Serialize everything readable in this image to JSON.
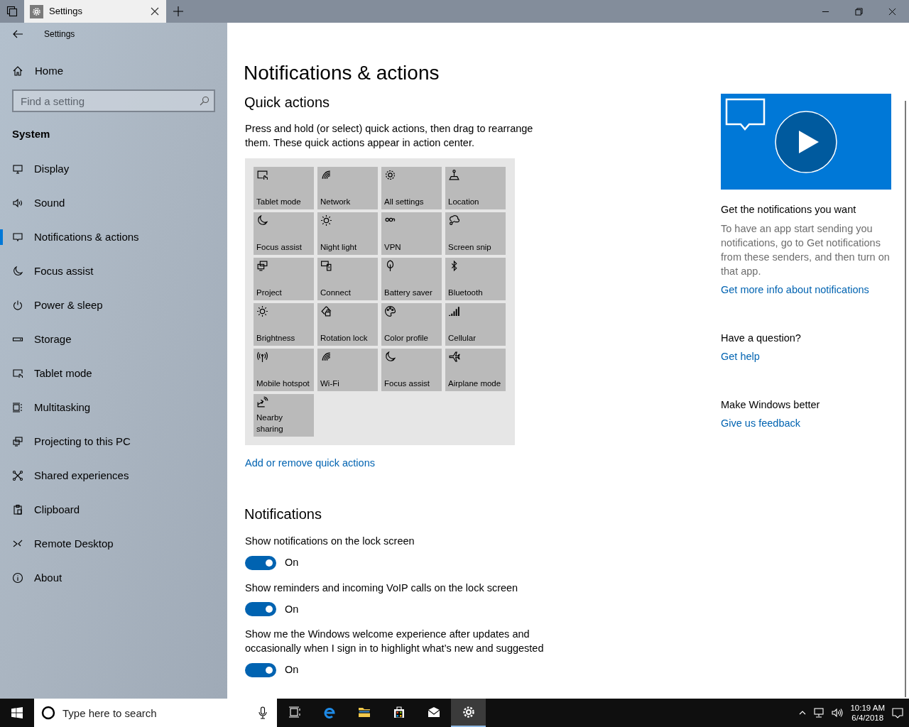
{
  "tabs": [
    {
      "label": "Settings",
      "selected": true
    }
  ],
  "window": {
    "title": "Settings"
  },
  "sidebar": {
    "home": "Home",
    "search": {
      "placeholder": "Find a setting"
    },
    "section": "System",
    "items": [
      {
        "label": "Display",
        "selected": false
      },
      {
        "label": "Sound",
        "selected": false
      },
      {
        "label": "Notifications & actions",
        "selected": true
      },
      {
        "label": "Focus assist",
        "selected": false
      },
      {
        "label": "Power & sleep",
        "selected": false
      },
      {
        "label": "Storage",
        "selected": false
      },
      {
        "label": "Tablet mode",
        "selected": false
      },
      {
        "label": "Multitasking",
        "selected": false
      },
      {
        "label": "Projecting to this PC",
        "selected": false
      },
      {
        "label": "Shared experiences",
        "selected": false
      },
      {
        "label": "Clipboard",
        "selected": false
      },
      {
        "label": "Remote Desktop",
        "selected": false
      },
      {
        "label": "About",
        "selected": false
      }
    ]
  },
  "page": {
    "title": "Notifications & actions",
    "quick_actions": {
      "heading": "Quick actions",
      "description": "Press and hold (or select) quick actions, then drag to rearrange them. These quick actions appear in action center.",
      "tiles": [
        {
          "label": "Tablet mode"
        },
        {
          "label": "Network"
        },
        {
          "label": "All settings"
        },
        {
          "label": "Location"
        },
        {
          "label": "Focus assist"
        },
        {
          "label": "Night light"
        },
        {
          "label": "VPN"
        },
        {
          "label": "Screen snip"
        },
        {
          "label": "Project"
        },
        {
          "label": "Connect"
        },
        {
          "label": "Battery saver"
        },
        {
          "label": "Bluetooth"
        },
        {
          "label": "Brightness"
        },
        {
          "label": "Rotation lock"
        },
        {
          "label": "Color profile"
        },
        {
          "label": "Cellular"
        },
        {
          "label": "Mobile hotspot"
        },
        {
          "label": "Wi-Fi"
        },
        {
          "label": "Focus assist"
        },
        {
          "label": "Airplane mode"
        },
        {
          "label": "Nearby sharing"
        }
      ],
      "link": "Add or remove quick actions"
    },
    "notifications": {
      "heading": "Notifications",
      "settings": [
        {
          "label": "Show notifications on the lock screen",
          "on": true,
          "state": "On"
        },
        {
          "label": "Show reminders and incoming VoIP calls on the lock screen",
          "on": true,
          "state": "On"
        },
        {
          "label": "Show me the Windows welcome experience after updates and occasionally when I sign in to highlight what’s new and suggested",
          "on": true,
          "state": "On"
        }
      ]
    }
  },
  "aside": {
    "sections": [
      {
        "heading": "Get the notifications you want",
        "text": "To have an app start sending you notifications, go to Get notifications from these senders, and then turn on that app.",
        "link": "Get more info about notifications"
      },
      {
        "heading": "Have a question?",
        "link": "Get help"
      },
      {
        "heading": "Make Windows better",
        "link": "Give us feedback"
      }
    ]
  },
  "taskbar": {
    "search": {
      "placeholder": "Type here to search"
    },
    "apps": [
      {
        "selected": false
      },
      {
        "selected": false
      },
      {
        "selected": false
      },
      {
        "selected": false
      },
      {
        "selected": false
      },
      {
        "selected": true
      }
    ],
    "time": "10:19 AM",
    "date": "6/4/2018"
  }
}
